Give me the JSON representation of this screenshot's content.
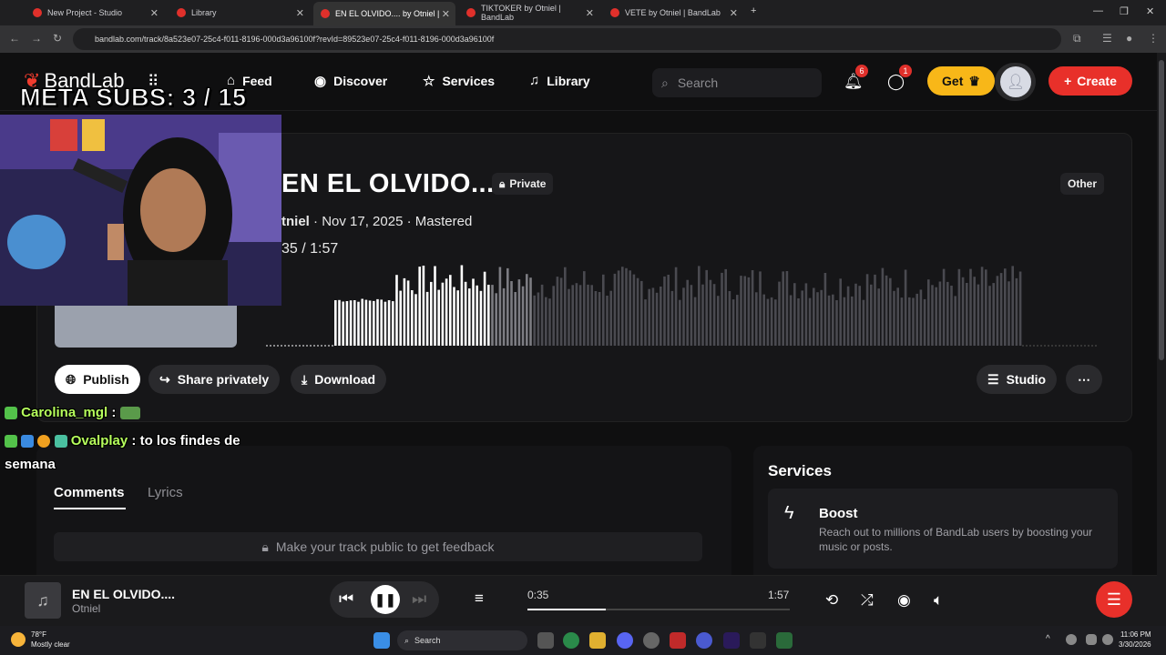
{
  "browser": {
    "tabs": [
      {
        "label": "New Project - Studio"
      },
      {
        "label": "Library"
      },
      {
        "label": "EN EL OLVIDO.... by Otniel |"
      },
      {
        "label": "TIKTOKER by Otniel | BandLab"
      },
      {
        "label": "VETE by Otniel | BandLab"
      }
    ],
    "url": "bandlab.com/track/8a523e07-25c4-f011-8196-000d3a96100f?revId=89523e07-25c4-f011-8196-000d3a96100f"
  },
  "header": {
    "logo": "BandLab",
    "nav": [
      {
        "label": "Feed",
        "icon": "home-icon"
      },
      {
        "label": "Discover",
        "icon": "play-circle-icon"
      },
      {
        "label": "Services",
        "icon": "star-icon"
      },
      {
        "label": "Library",
        "icon": "music-library-icon"
      }
    ],
    "search_placeholder": "Search",
    "notifications_count": "6",
    "messages_count": "1",
    "get_label": "Get",
    "create_label": "Create",
    "accent": "#e8302a",
    "get_color": "#f8b718"
  },
  "track": {
    "title": "EN EL OLVIDO....",
    "privacy": "Private",
    "genre": "Other",
    "artist_partial": "tniel",
    "date": "Nov 17, 2025",
    "status": "Mastered",
    "time_display": "35 /  1:57",
    "actions": {
      "publish": "Publish",
      "share": "Share privately",
      "download": "Download",
      "studio": "Studio"
    },
    "progress_fraction": 0.29
  },
  "comments": {
    "tabs": [
      "Comments",
      "Lyrics"
    ],
    "active_tab": "Comments",
    "feedback_text": "Make your track public to get feedback"
  },
  "services": {
    "title": "Services",
    "boost_title": "Boost",
    "boost_desc": "Reach out to millions of BandLab users by boosting your music or posts."
  },
  "player": {
    "title": "EN EL OLVIDO....",
    "artist": "Otniel",
    "current": "0:35",
    "duration": "1:57",
    "progress_fraction": 0.3
  },
  "overlay": {
    "meta_subs": "META SUBS: 3 / 15",
    "chat": [
      {
        "user": "Carolina_mgl",
        "text": ":"
      },
      {
        "user": "Ovalplay",
        "text": ": to los findes de"
      },
      {
        "user": "",
        "text": "semana"
      }
    ]
  },
  "taskbar": {
    "temp": "78°F",
    "weather": "Mostly clear",
    "search": "Search",
    "time": "11:06 PM",
    "date": "3/30/2026"
  }
}
